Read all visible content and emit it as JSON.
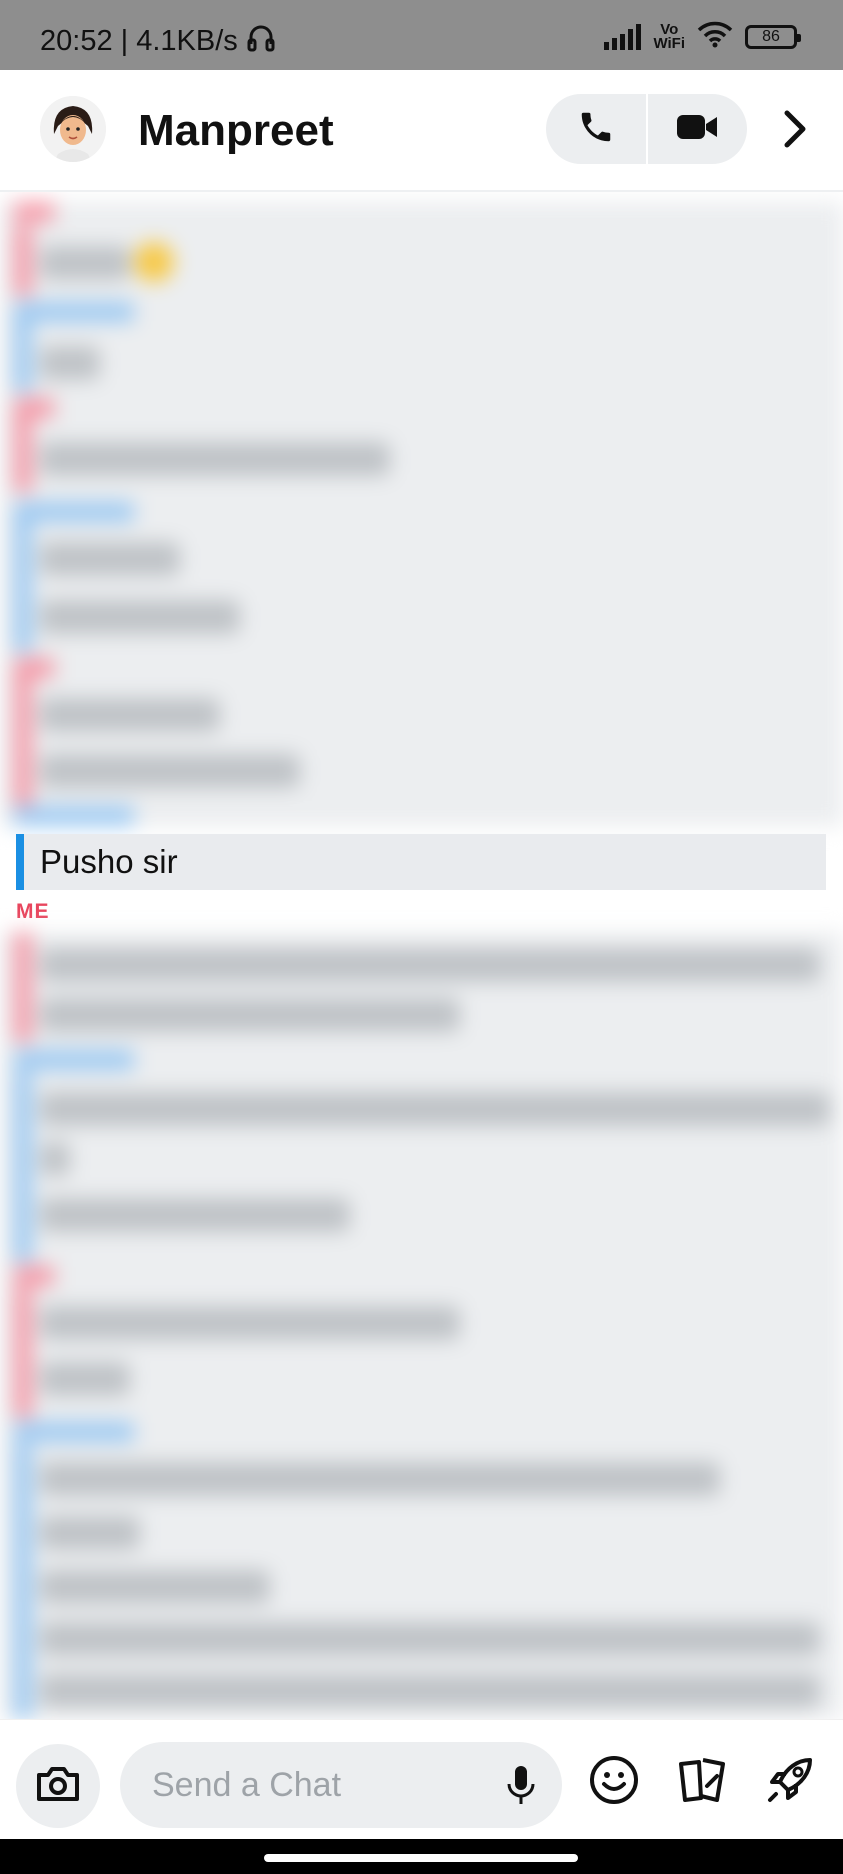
{
  "status_bar": {
    "time_speed": "20:52 | 4.1KB/s",
    "network_label_top": "Vo",
    "network_label_bottom": "WiFi",
    "battery": "86",
    "icons": [
      "headphones-icon",
      "signal-icon",
      "vowifi-icon",
      "wifi-icon",
      "battery-icon"
    ]
  },
  "header": {
    "contact_name": "Manpreet",
    "icons": [
      "avatar",
      "phone-icon",
      "video-icon",
      "chevron-right-icon"
    ]
  },
  "chat": {
    "visible_message": "Pusho sir",
    "sender_label": "ME",
    "colors": {
      "friend": "#1a8fe3",
      "me": "#e8465e",
      "bubble_bg": "#e9ebee"
    }
  },
  "composer": {
    "placeholder": "Send a Chat",
    "icons": [
      "camera-icon",
      "mic-icon",
      "emoji-icon",
      "cards-icon",
      "rocket-icon"
    ]
  }
}
